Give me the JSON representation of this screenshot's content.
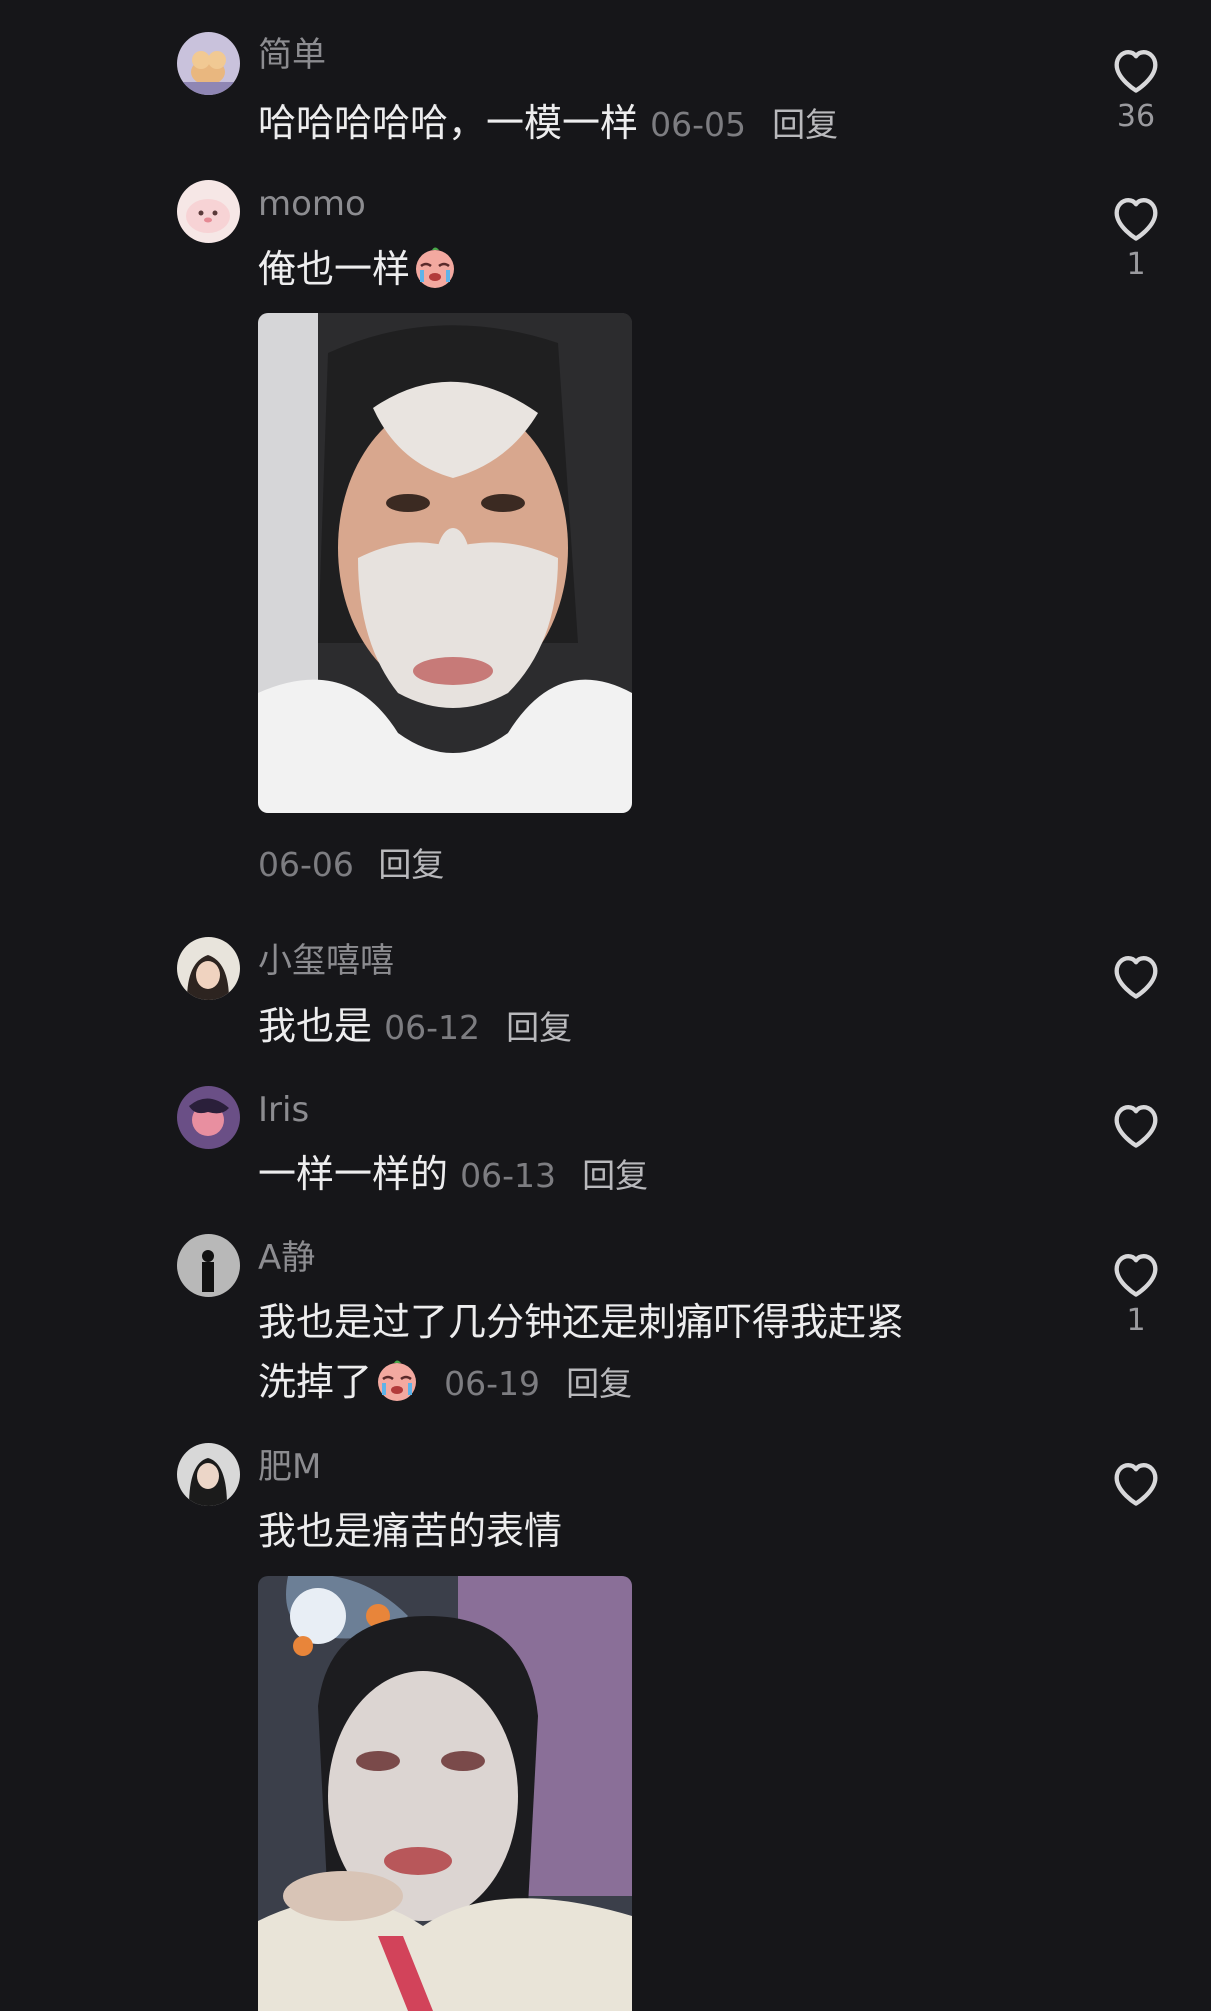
{
  "comments": [
    {
      "username": "简单",
      "text": "哈哈哈哈哈，一模一样",
      "date": "06-05",
      "reply": "回复",
      "likes": "36"
    },
    {
      "username": "momo",
      "text": "俺也一样",
      "emoji": "crying-face",
      "date": "06-06",
      "reply": "回复",
      "likes": "1",
      "image": "selfie with face mask"
    },
    {
      "username": "小玺嘻嘻",
      "text": "我也是",
      "date": "06-12",
      "reply": "回复",
      "likes": ""
    },
    {
      "username": "Iris",
      "text": "一样一样的",
      "date": "06-13",
      "reply": "回复",
      "likes": ""
    },
    {
      "username": "A静",
      "text_line1": "我也是过了几分钟还是刺痛吓得我赶紧",
      "text_line2": "洗掉了",
      "emoji": "crying-face",
      "date": "06-19",
      "reply": "回复",
      "likes": "1"
    },
    {
      "username": "肥M",
      "text": "我也是痛苦的表情",
      "date": "",
      "reply": "",
      "likes": "",
      "image": "selfie with face mask and plush toy"
    }
  ],
  "colors": {
    "background": "#161619",
    "text": "#ededee",
    "muted": "#8c8c90",
    "like_icon": "#d8d8da"
  },
  "icons": {
    "like": "heart-outline-icon",
    "emoji": "crying-face-emoji"
  }
}
